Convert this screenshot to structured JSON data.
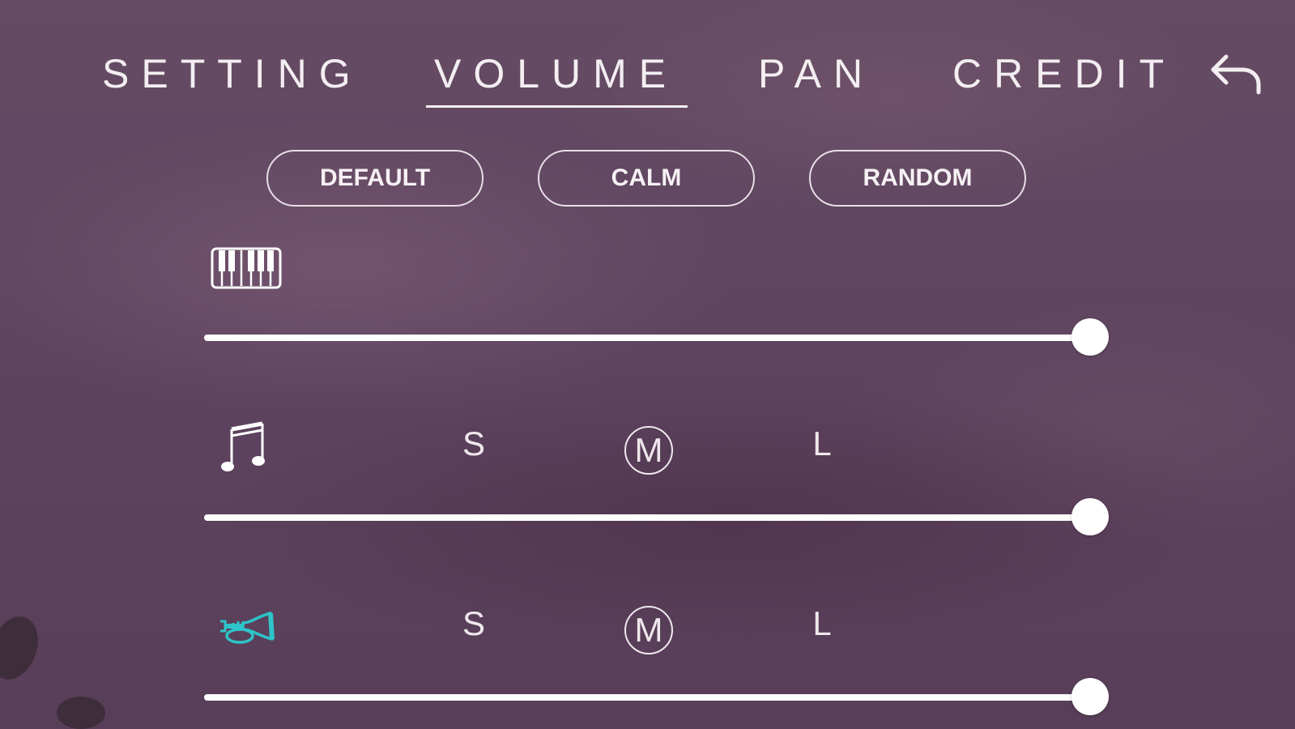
{
  "nav": {
    "tabs": [
      {
        "label": "SETTING",
        "active": false
      },
      {
        "label": "VOLUME",
        "active": true
      },
      {
        "label": "PAN",
        "active": false
      },
      {
        "label": "CREDIT",
        "active": false
      }
    ],
    "back_icon": "undo-arrow-icon"
  },
  "presets": [
    {
      "label": "DEFAULT"
    },
    {
      "label": "CALM"
    },
    {
      "label": "RANDOM"
    }
  ],
  "tracks": [
    {
      "icon": "piano-keyboard-icon",
      "icon_color": "#ffffff",
      "volume": 1.0
    },
    {
      "icon": "music-note-icon",
      "icon_color": "#ffffff",
      "sizes": [
        "S",
        "M",
        "L"
      ],
      "selected_size": "M",
      "volume": 1.0
    },
    {
      "icon": "trumpet-icon",
      "icon_color": "#2ec4c9",
      "sizes": [
        "S",
        "M",
        "L"
      ],
      "selected_size": "M",
      "volume": 1.0
    }
  ],
  "colors": {
    "background": "#5e4460",
    "foreground": "#ffffff",
    "accent": "#2ec4c9"
  }
}
